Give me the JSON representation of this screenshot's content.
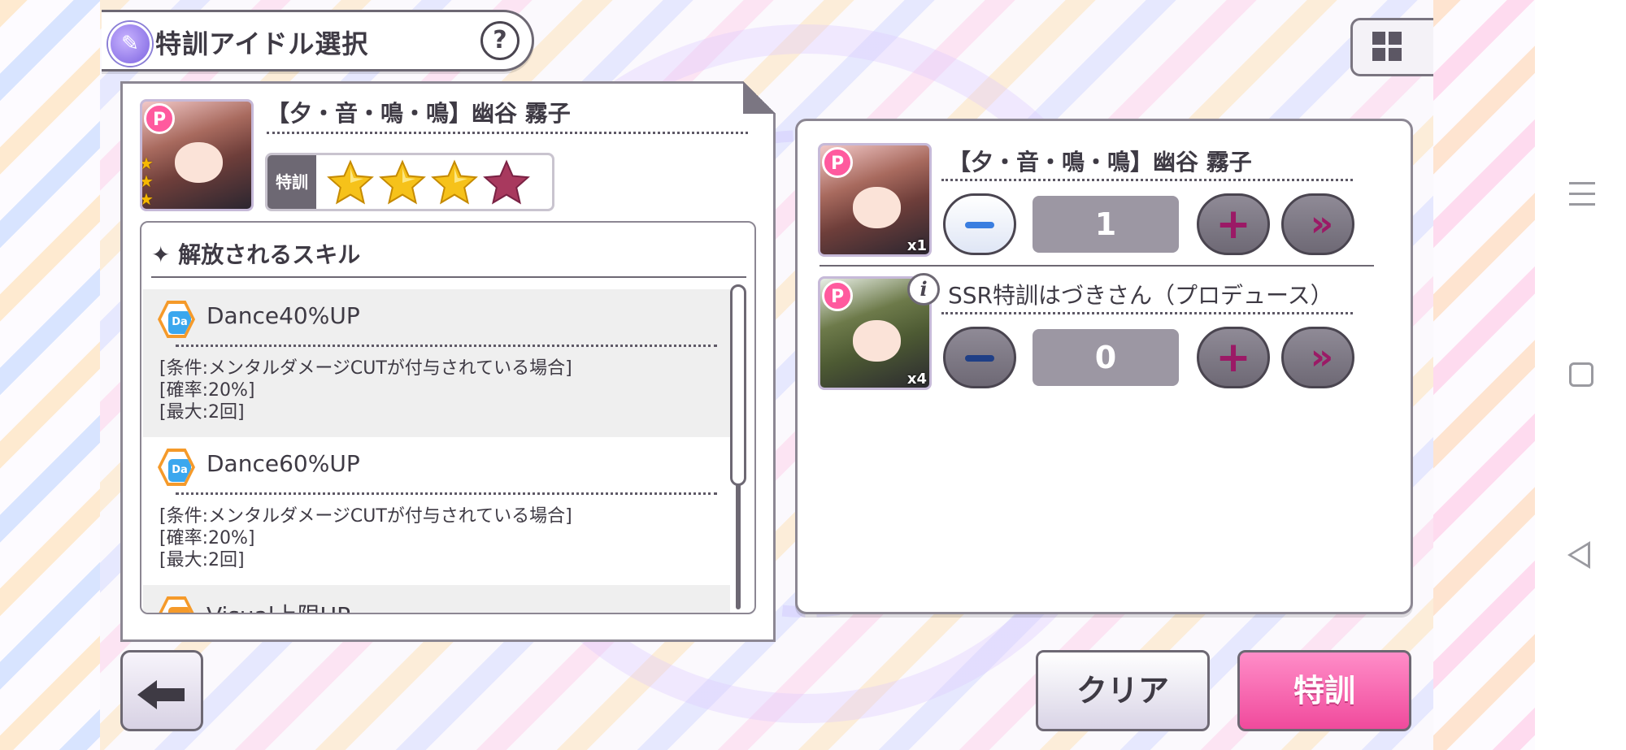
{
  "header": {
    "title": "特訓アイドル選択",
    "help_label": "?"
  },
  "selected_card": {
    "name": "【夕・音・鳴・鳴】幽谷 霧子",
    "badge": "P",
    "training_label": "特訓",
    "training_stars": {
      "filled": 3,
      "total": 4,
      "filled_color": "#f6c21a",
      "empty_color": "#a8395e"
    }
  },
  "skills": {
    "heading": "✦ 解放されるスキル",
    "items": [
      {
        "icon_text": "Da",
        "name": "Dance40%UP",
        "conditions": [
          "[条件:メンタルダメージCUTが付与されている場合]",
          "[確率:20%]",
          "[最大:2回]"
        ]
      },
      {
        "icon_text": "Da",
        "name": "Dance60%UP",
        "conditions": [
          "[条件:メンタルダメージCUTが付与されている場合]",
          "[確率:20%]",
          "[最大:2回]"
        ]
      },
      {
        "icon_text": "Vi",
        "name": "Visual上限UP",
        "conditions": []
      }
    ]
  },
  "material_rows": [
    {
      "name": "【夕・音・鳴・鳴】幽谷 霧子",
      "owned": "x1",
      "count": "1",
      "badge": "P"
    },
    {
      "name": "SSR特訓はづきさん（プロデュース）",
      "owned": "x4",
      "count": "0",
      "badge": "P",
      "info": "i"
    }
  ],
  "footer": {
    "clear_label": "クリア",
    "train_label": "特訓"
  },
  "colors": {
    "accent_pink": "#f04a9c",
    "button_magenta": "#9b1a66",
    "panel_border": "#8c8793",
    "dance_blue": "#3ba7ee",
    "skill_orange": "#f59a2a"
  },
  "icons": [
    "title-orb-icon",
    "help-icon",
    "grid-view-icon",
    "back-arrow-icon",
    "info-icon",
    "plus-icon",
    "minus-icon",
    "max-icon",
    "star-icon"
  ]
}
